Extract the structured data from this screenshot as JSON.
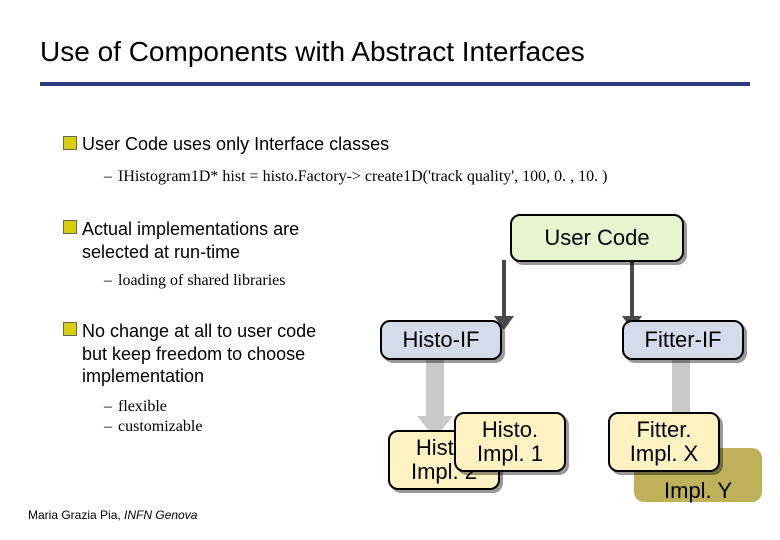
{
  "title": "Use of Components with Abstract Interfaces",
  "bullets": {
    "b1": "User Code uses only Interface classes",
    "b1_code": "IHistogram1D* hist = histo.Factory-> create1D('track quality', 100, 0. , 10. )",
    "b2": "Actual implementations are selected at run-time",
    "b2_sub": "loading of shared libraries",
    "b3": "No change at all to user code but keep freedom to choose implementation",
    "b3_sub1": "flexible",
    "b3_sub2": "customizable"
  },
  "boxes": {
    "user_code": "User Code",
    "histo_if": "Histo-IF",
    "fitter_if": "Fitter-IF",
    "histo_impl2": "Histo. Impl. 2",
    "histo_impl1": "Histo. Impl. 1",
    "fitter_implx": "Fitter. Impl. X",
    "impl_y": "Impl. Y"
  },
  "footer": {
    "author": "Maria Grazia Pia, ",
    "inst": "INFN Genova"
  }
}
